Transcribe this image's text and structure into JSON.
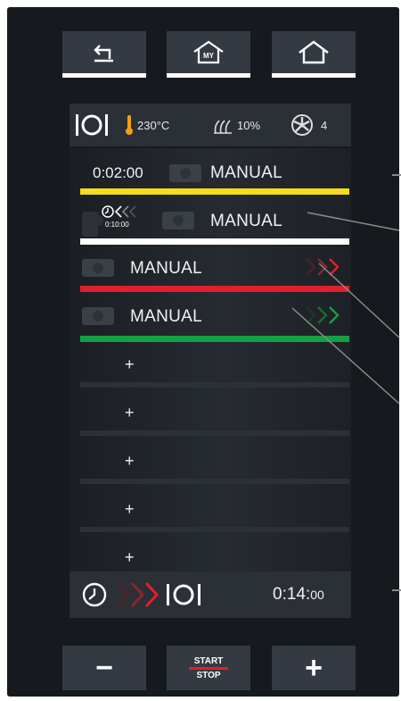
{
  "top_buttons": [
    {
      "name": "back",
      "icon": "back-arrow-icon"
    },
    {
      "name": "my-home",
      "icon": "my-home-icon",
      "badge": "MY"
    },
    {
      "name": "home",
      "icon": "home-icon"
    }
  ],
  "info_bar": {
    "mode_icon": "plate-cutlery-icon",
    "temperature": "230°C",
    "humidity": "10%",
    "fan_speed": "4"
  },
  "program_list": [
    {
      "time": "0:02:00",
      "label": "MANUAL",
      "bar_color": "#f5dd1a"
    },
    {
      "sub_time": "0:10:00",
      "label": "MANUAL",
      "bar_color": "#ffffff"
    },
    {
      "label": "MANUAL",
      "bar_color": "#e0202e",
      "arrow_color": "#e0202e"
    },
    {
      "label": "MANUAL",
      "bar_color": "#15a043",
      "arrow_color": "#15a043"
    }
  ],
  "empty_slots": [
    "+",
    "+",
    "+",
    "+",
    "+"
  ],
  "summary": {
    "total_main": "0:14:",
    "total_small": "00"
  },
  "bottom_buttons": {
    "minus": "−",
    "start": "START",
    "stop": "STOP",
    "plus": "+"
  },
  "colors": {
    "background": "#16191d",
    "panel": "#2b3037",
    "button": "#343a42",
    "yellow": "#f5dd1a",
    "red": "#e0202e",
    "green": "#15a043"
  }
}
